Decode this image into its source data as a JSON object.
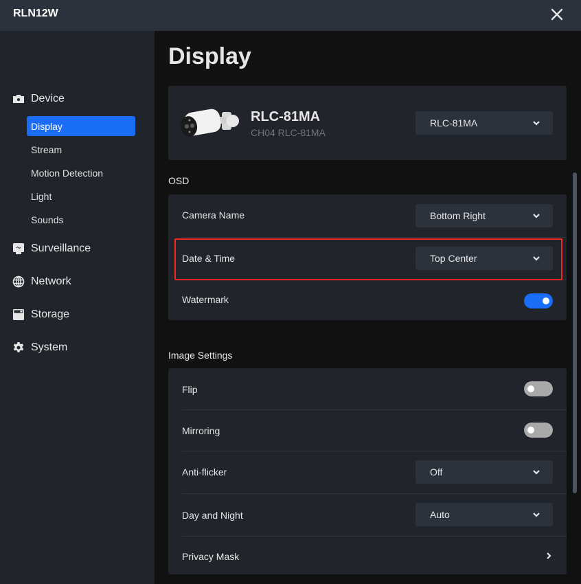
{
  "window": {
    "title": "RLN12W",
    "close_icon": "close-icon"
  },
  "sidebar": {
    "groups": [
      {
        "label": "Device",
        "icon": "camera-icon"
      },
      {
        "label": "Surveillance",
        "icon": "monitor-icon"
      },
      {
        "label": "Network",
        "icon": "globe-icon"
      },
      {
        "label": "Storage",
        "icon": "storage-icon"
      },
      {
        "label": "System",
        "icon": "gear-icon"
      }
    ],
    "device_items": [
      {
        "label": "Display",
        "active": true
      },
      {
        "label": "Stream",
        "active": false
      },
      {
        "label": "Motion Detection",
        "active": false
      },
      {
        "label": "Light",
        "active": false
      },
      {
        "label": "Sounds",
        "active": false
      }
    ]
  },
  "main": {
    "title": "Display",
    "device": {
      "name": "RLC-81MA",
      "channel": "CH04 RLC-81MA",
      "selector_value": "RLC-81MA"
    },
    "osd": {
      "section_label": "OSD",
      "camera_name": {
        "label": "Camera Name",
        "value": "Bottom Right"
      },
      "date_time": {
        "label": "Date & Time",
        "value": "Top Center"
      },
      "watermark": {
        "label": "Watermark",
        "enabled": true
      }
    },
    "image_settings": {
      "section_label": "Image Settings",
      "flip": {
        "label": "Flip",
        "enabled": false
      },
      "mirroring": {
        "label": "Mirroring",
        "enabled": false
      },
      "anti_flicker": {
        "label": "Anti-flicker",
        "value": "Off"
      },
      "day_night": {
        "label": "Day and Night",
        "value": "Auto"
      },
      "privacy_mask": {
        "label": "Privacy Mask"
      }
    }
  },
  "colors": {
    "accent": "#1a6ef5",
    "highlight_border": "#f0281e",
    "toggle_off": "#a9a9a9"
  }
}
